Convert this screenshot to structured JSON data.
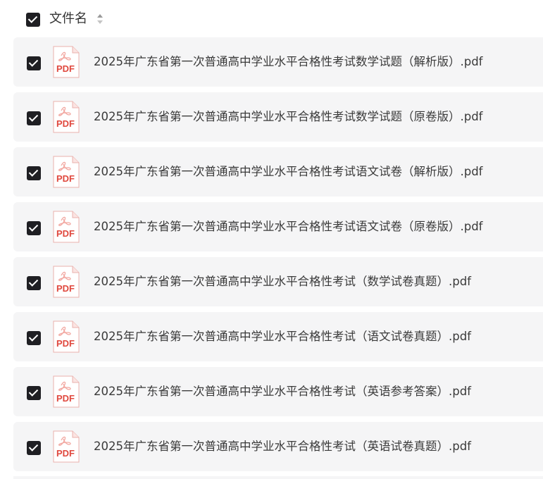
{
  "header": {
    "select_all_checked": true,
    "column_label": "文件名",
    "sort_icon": "sort-updown-icon"
  },
  "files": [
    {
      "name": "2025年广东省第一次普通高中学业水平合格性考试数学试题（解析版）.pdf",
      "checked": true,
      "icon": "pdf-file-icon",
      "icon_text": "PDF"
    },
    {
      "name": "2025年广东省第一次普通高中学业水平合格性考试数学试题（原卷版）.pdf",
      "checked": true,
      "icon": "pdf-file-icon",
      "icon_text": "PDF"
    },
    {
      "name": "2025年广东省第一次普通高中学业水平合格性考试语文试卷（解析版）.pdf",
      "checked": true,
      "icon": "pdf-file-icon",
      "icon_text": "PDF"
    },
    {
      "name": "2025年广东省第一次普通高中学业水平合格性考试语文试卷（原卷版）.pdf",
      "checked": true,
      "icon": "pdf-file-icon",
      "icon_text": "PDF"
    },
    {
      "name": "2025年广东省第一次普通高中学业水平合格性考试（数学试卷真题）.pdf",
      "checked": true,
      "icon": "pdf-file-icon",
      "icon_text": "PDF"
    },
    {
      "name": "2025年广东省第一次普通高中学业水平合格性考试（语文试卷真题）.pdf",
      "checked": true,
      "icon": "pdf-file-icon",
      "icon_text": "PDF"
    },
    {
      "name": "2025年广东省第一次普通高中学业水平合格性考试（英语参考答案）.pdf",
      "checked": true,
      "icon": "pdf-file-icon",
      "icon_text": "PDF"
    },
    {
      "name": "2025年广东省第一次普通高中学业水平合格性考试（英语试卷真题）.pdf",
      "checked": true,
      "icon": "pdf-file-icon",
      "icon_text": "PDF"
    }
  ],
  "colors": {
    "checkbox": "#1f1f23",
    "row_bg": "#f5f5f6",
    "pdf_red": "#e0483e"
  }
}
